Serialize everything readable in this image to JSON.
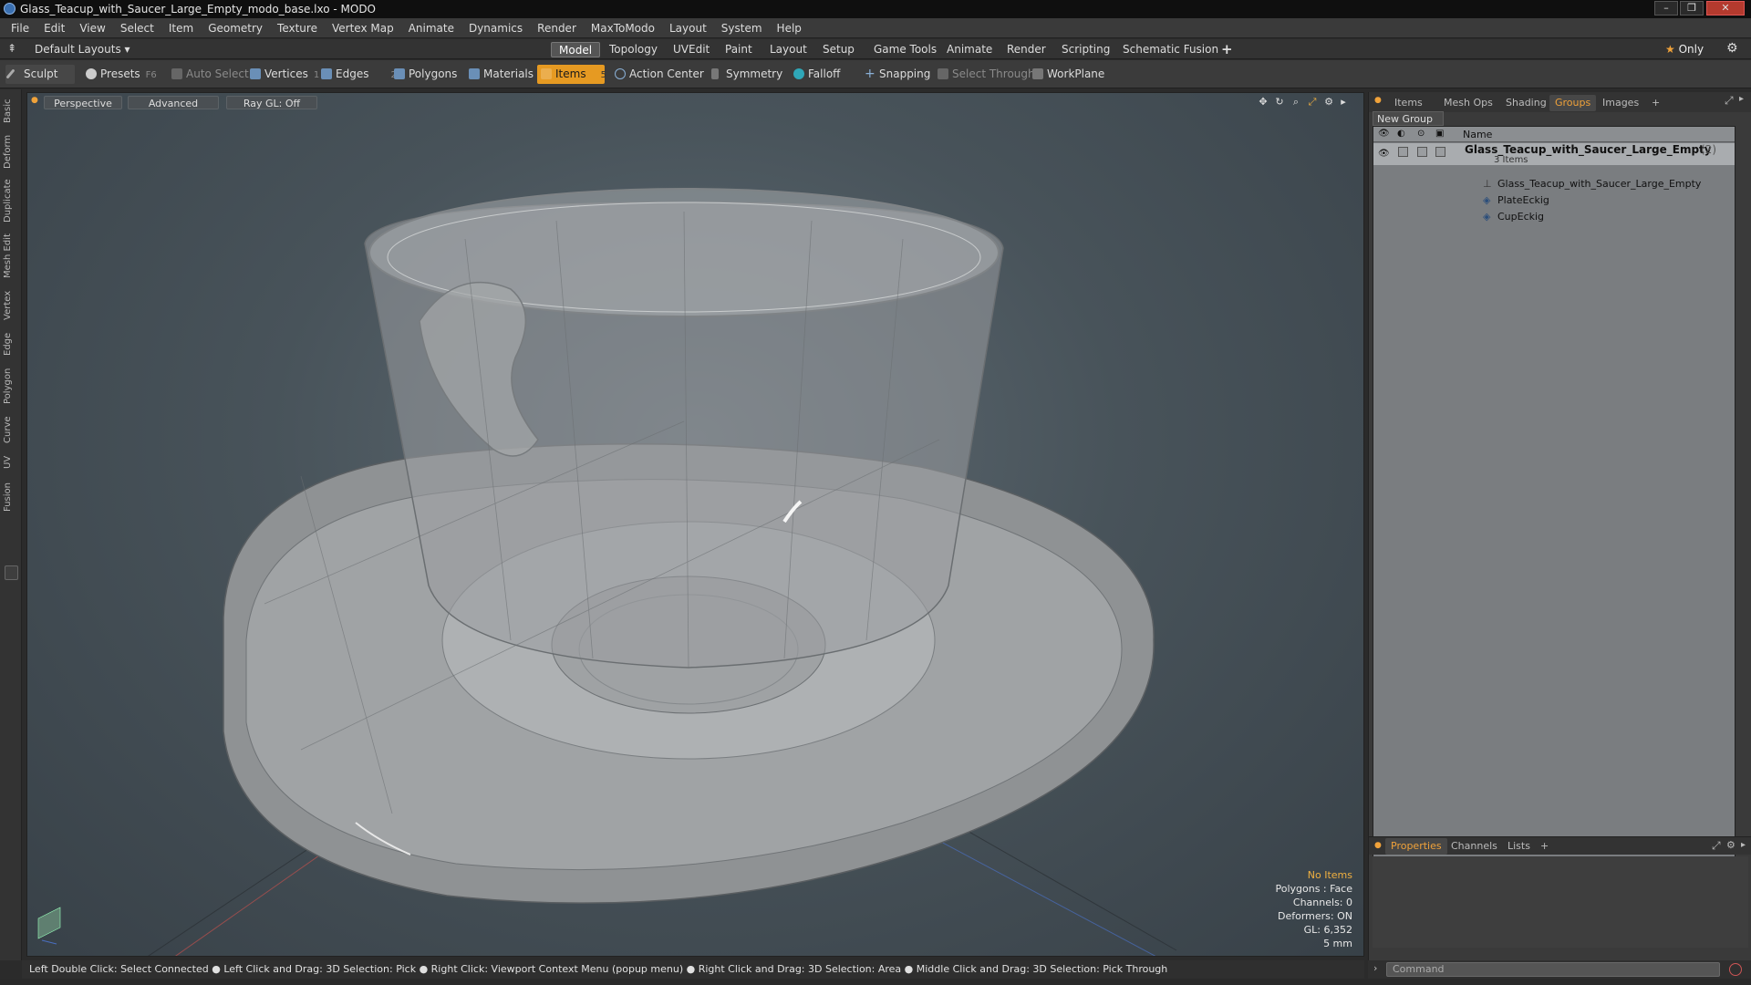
{
  "window": {
    "title": "Glass_Teacup_with_Saucer_Large_Empty_modo_base.lxo - MODO",
    "controls": [
      "–",
      "❐",
      "✕"
    ]
  },
  "menu": [
    "File",
    "Edit",
    "View",
    "Select",
    "Item",
    "Geometry",
    "Texture",
    "Vertex Map",
    "Animate",
    "Dynamics",
    "Render",
    "MaxToModo",
    "Layout",
    "System",
    "Help"
  ],
  "layoutbar": {
    "layouts_label": "Default Layouts",
    "tabs": [
      "Model",
      "Topology",
      "UVEdit",
      "Paint",
      "Layout",
      "Setup",
      "Game Tools",
      "Animate",
      "Render",
      "Scripting",
      "Schematic Fusion"
    ],
    "active_tab": "Model",
    "add": "+",
    "only_label": "Only"
  },
  "toolbar": {
    "sculpt": "Sculpt",
    "presets": "Presets",
    "presets_key": "F6",
    "auto_select": "Auto Select",
    "vertices": "Vertices",
    "vertices_count": "1",
    "edges": "Edges",
    "edges_count": "2",
    "polygons": "Polygons",
    "materials": "Materials",
    "items": "Items",
    "items_count": "5",
    "action_center": "Action Center",
    "symmetry": "Symmetry",
    "falloff": "Falloff",
    "snapping": "Snapping",
    "select_through": "Select Through",
    "workplane": "WorkPlane"
  },
  "left_tabs": [
    "Basic",
    "Deform",
    "Duplicate",
    "Mesh Edit",
    "Vertex",
    "Edge",
    "Polygon",
    "Curve",
    "UV",
    "Fusion"
  ],
  "viewport": {
    "view_label": "Perspective",
    "style_label": "Advanced",
    "raygl_label": "Ray GL: Off",
    "info": {
      "title": "No Items",
      "polygons": "Polygons : Face",
      "channels": "Channels: 0",
      "deformers": "Deformers: ON",
      "gl": "GL: 6,352",
      "unit": "5 mm"
    }
  },
  "right_panel": {
    "tabs": [
      "Items",
      "Mesh Ops",
      "Shading",
      "Groups",
      "Images"
    ],
    "active_tab": "Groups",
    "add": "+",
    "new_group": "New Group",
    "column_name": "Name",
    "group": {
      "name": "Glass_Teacup_with_Saucer_Large_Empty",
      "count": "(2)",
      "sub": "3 Items",
      "children": [
        "Glass_Teacup_with_Saucer_Large_Empty",
        "PlateEckig",
        "CupEckig"
      ]
    },
    "bottom_tabs": [
      "Properties",
      "Channels",
      "Lists"
    ],
    "bottom_active": "Properties",
    "bottom_add": "+"
  },
  "status": {
    "hints": "Left Double Click: Select Connected ● Left Click and Drag: 3D Selection: Pick ● Right Click: Viewport Context Menu (popup menu) ● Right Click and Drag: 3D Selection: Area ● Middle Click and Drag: 3D Selection: Pick Through"
  },
  "command": {
    "placeholder": "Command"
  },
  "colors": {
    "accent": "#f0a23a",
    "active_tool": "#e69a22"
  }
}
